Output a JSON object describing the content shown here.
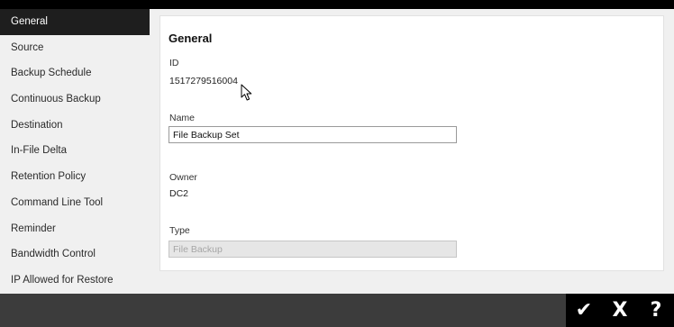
{
  "sidebar": {
    "items": [
      {
        "label": "General",
        "active": true
      },
      {
        "label": "Source"
      },
      {
        "label": "Backup Schedule"
      },
      {
        "label": "Continuous Backup"
      },
      {
        "label": "Destination"
      },
      {
        "label": "In-File Delta"
      },
      {
        "label": "Retention Policy"
      },
      {
        "label": "Command Line Tool"
      },
      {
        "label": "Reminder"
      },
      {
        "label": "Bandwidth Control"
      },
      {
        "label": "IP Allowed for Restore"
      }
    ]
  },
  "main": {
    "title": "General",
    "id": {
      "label": "ID",
      "value": "1517279516004"
    },
    "name": {
      "label": "Name",
      "value": "File Backup Set"
    },
    "owner": {
      "label": "Owner",
      "value": "DC2"
    },
    "type": {
      "label": "Type",
      "value": "File Backup"
    }
  },
  "actions": {
    "ok": {
      "icon": "checkmark-icon",
      "glyph": "✔"
    },
    "cancel": {
      "icon": "close-icon",
      "glyph": "X"
    },
    "help": {
      "icon": "help-icon",
      "glyph": "?"
    }
  },
  "colors": {
    "sidebar_bg": "#f0f0f0",
    "sidebar_active_bg": "#1e1e1e",
    "bottom_bar": "#3c3c3c",
    "action_bar": "#000000"
  }
}
